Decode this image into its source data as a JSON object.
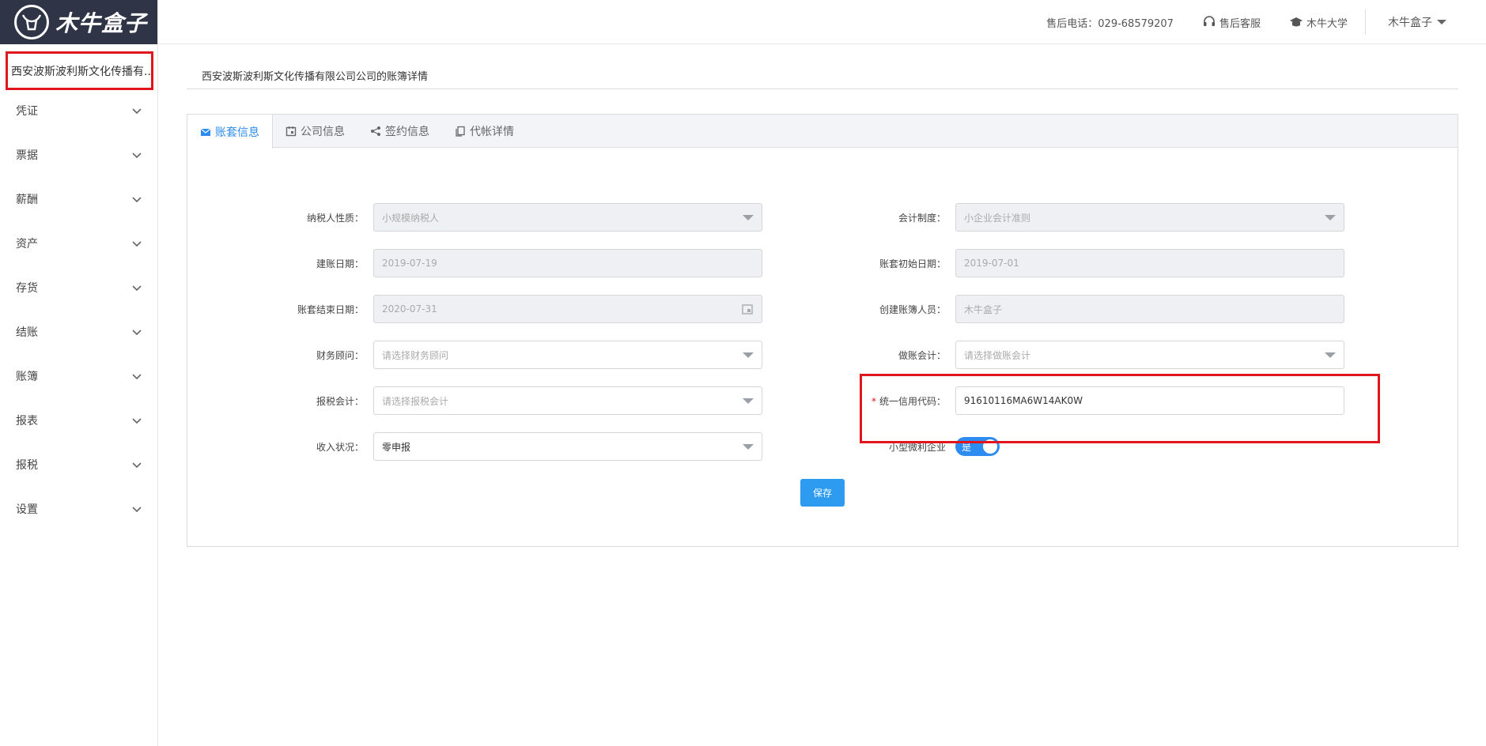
{
  "brand": {
    "name": "木牛盒子"
  },
  "sidebar": {
    "org_name": "西安波斯波利斯文化传播有...",
    "items": [
      {
        "label": "凭证"
      },
      {
        "label": "票据"
      },
      {
        "label": "薪酬"
      },
      {
        "label": "资产"
      },
      {
        "label": "存货"
      },
      {
        "label": "结账"
      },
      {
        "label": "账簿"
      },
      {
        "label": "报表"
      },
      {
        "label": "报税"
      },
      {
        "label": "设置"
      }
    ]
  },
  "header": {
    "phone": "售后电话：029-68579207",
    "support": "售后客服",
    "university": "木牛大学",
    "user": "木牛盒子"
  },
  "page": {
    "title": "西安波斯波利斯文化传播有限公司公司的账簿详情"
  },
  "tabs": [
    {
      "label": "账套信息",
      "icon": "envelope-icon"
    },
    {
      "label": "公司信息",
      "icon": "calendar-icon"
    },
    {
      "label": "签约信息",
      "icon": "share-icon"
    },
    {
      "label": "代帐详情",
      "icon": "copy-icon"
    }
  ],
  "form": {
    "taxpayer_type": {
      "label": "纳税人性质：",
      "value": "小规模纳税人"
    },
    "accounting_system": {
      "label": "会计制度：",
      "value": "小企业会计准则"
    },
    "setup_date": {
      "label": "建账日期：",
      "value": "2019-07-19"
    },
    "start_date": {
      "label": "账套初始日期：",
      "value": "2019-07-01"
    },
    "end_date": {
      "label": "账套结束日期：",
      "value": "2020-07-31"
    },
    "creator": {
      "label": "创建账簿人员：",
      "value": "木牛盒子"
    },
    "finance_advisor": {
      "label": "财务顾问：",
      "placeholder": "请选择财务顾问"
    },
    "bookkeeper": {
      "label": "做账会计：",
      "placeholder": "请选择做账会计"
    },
    "tax_accountant": {
      "label": "报税会计：",
      "placeholder": "请选择报税会计"
    },
    "credit_code": {
      "label": "统一信用代码：",
      "required_mark": "*",
      "value": "91610116MA6W14AK0W"
    },
    "income_status": {
      "label": "收入状况：",
      "value": "零申报"
    },
    "small_micro": {
      "label": "小型微利企业",
      "toggle_text": "是"
    }
  },
  "actions": {
    "save": "保存"
  },
  "colors": {
    "accent": "#2d8cf0",
    "highlight": "#e0151d",
    "logo_bg": "#2f3547"
  }
}
